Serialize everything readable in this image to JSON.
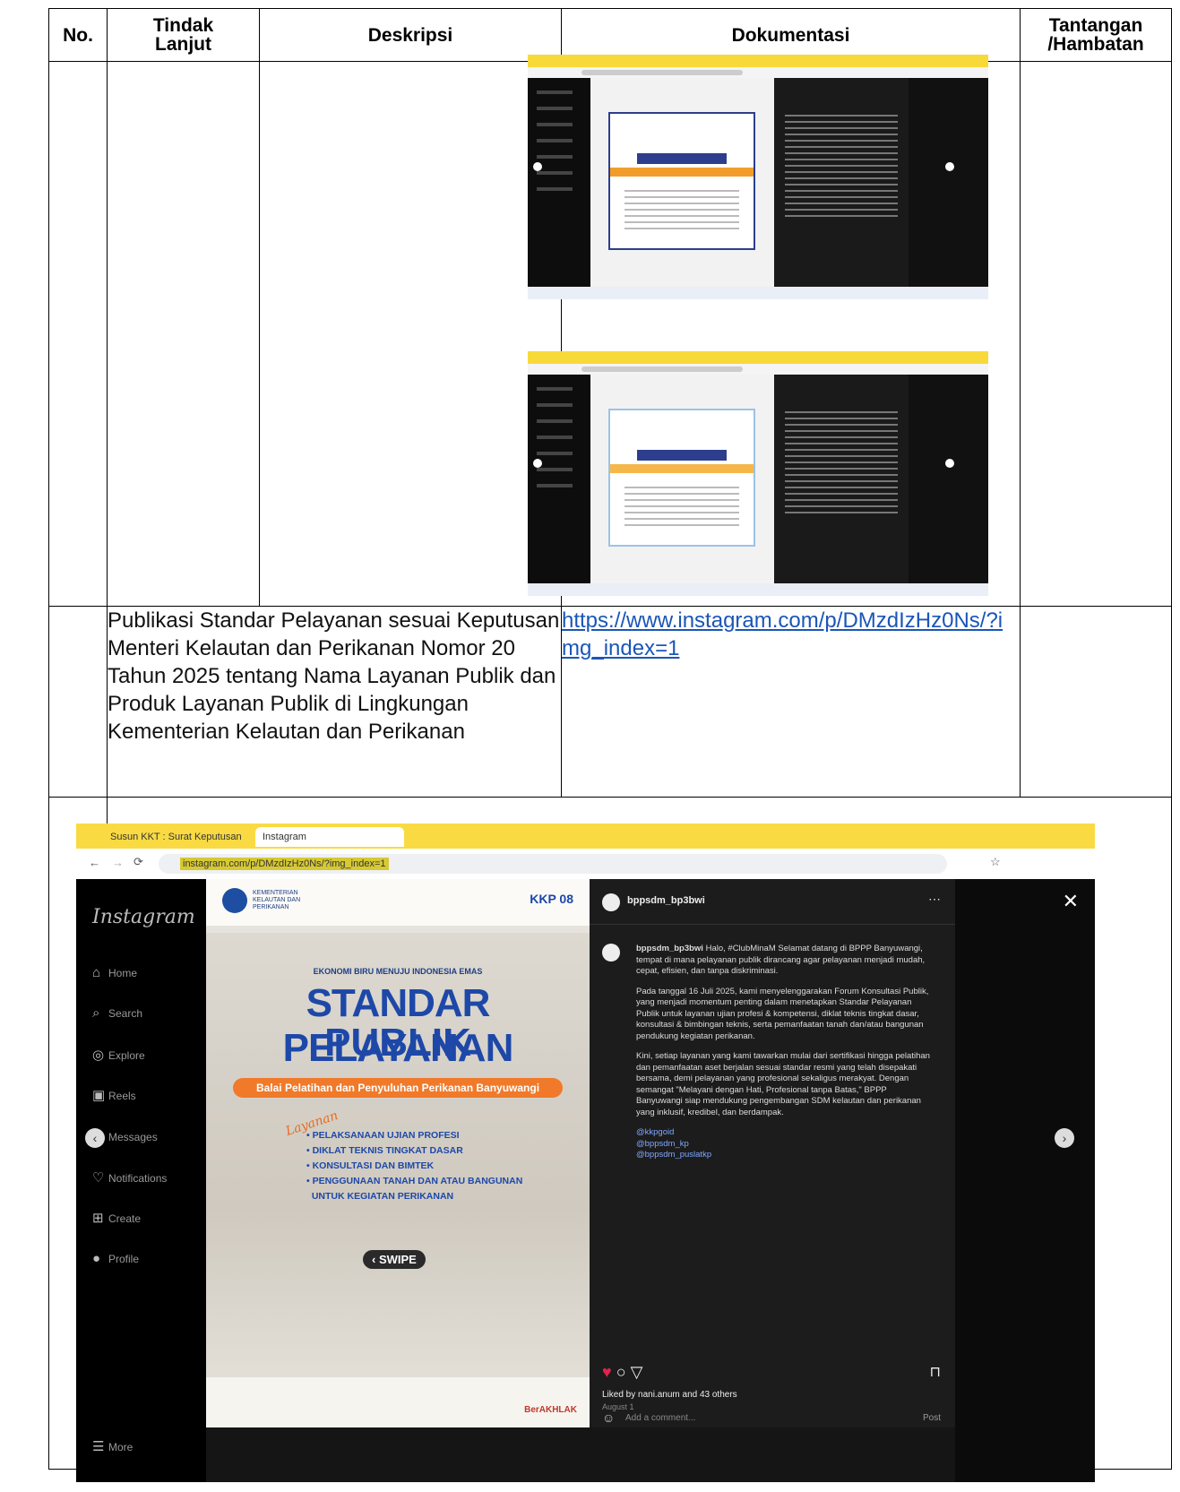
{
  "headers": {
    "no": "No.",
    "tindak_lanjut": "Tindak Lanjut",
    "deskripsi": "Deskripsi",
    "dokumentasi": "Dokumentasi",
    "tantangan": "Tantangan /Hambatan"
  },
  "row2": {
    "description": "Publikasi Standar Pelayanan sesuai Keputusan Menteri Kelautan dan Perikanan Nomor 20 Tahun 2025 tentang Nama Layanan Publik dan Produk Layanan Publik di Lingkungan Kementerian Kelautan dan Perikanan",
    "link": "https://www.instagram.com/p/DMzdIzHz0Ns/?img_index=1"
  },
  "mini_shots": [
    {
      "card_label": "MAKLUMAT",
      "band_color": "#f29d2b"
    },
    {
      "card_label": "MAKLUMAT",
      "band_color": "#f6b74a"
    }
  ],
  "screenshot": {
    "tab1": "Susun KKT : Surat Keputusan",
    "tab2": "Instagram",
    "url": "instagram.com/p/DMzdIzHz0Ns/?img_index=1",
    "sidebar": {
      "logo": "Instagram",
      "items": [
        "Home",
        "Search",
        "Explore",
        "Reels",
        "Messages",
        "Notifications",
        "Create",
        "Profile"
      ],
      "more": "More"
    },
    "post": {
      "org": "KEMENTERIAN KELAUTAN DAN PERIKANAN",
      "eco": "EKONOMI BIRU MENUJU INDONESIA EMAS",
      "title1": "STANDAR PELAYANAN",
      "title2": "PUBLIK",
      "ribbon": "Balai Pelatihan dan Penyuluhan Perikanan Banyuwangi",
      "layanan": "Layanan",
      "services": [
        "PELAKSANAAN UJIAN PROFESI",
        "DIKLAT TEKNIS TINGKAT DASAR",
        "KONSULTASI DAN BIMTEK",
        "PENGGUNAAN TANAH DAN ATAU BANGUNAN",
        "UNTUK KEGIATAN PERIKANAN"
      ],
      "swipe": "SWIPE",
      "berakhlak": "BerAKHLAK",
      "logos": "KKP 08"
    },
    "panel": {
      "username": "bppsdm_bp3bwi",
      "caption_user": "bppsdm_bp3bwi",
      "caption_p1": "Halo, #ClubMinaM Selamat datang di BPPP Banyuwangi, tempat di mana pelayanan publik dirancang agar pelayanan menjadi mudah, cepat, efisien, dan tanpa diskriminasi.",
      "caption_p2": "Pada tanggal 16 Juli 2025, kami menyelenggarakan Forum Konsultasi Publik, yang menjadi momentum penting dalam menetapkan Standar Pelayanan Publik untuk layanan ujian profesi & kompetensi, diklat teknis tingkat dasar, konsultasi & bimbingan teknis, serta pemanfaatan tanah dan/atau bangunan pendukung kegiatan perikanan.",
      "caption_p3": "Kini, setiap layanan yang kami tawarkan mulai dari sertifikasi hingga pelatihan dan pemanfaatan aset berjalan sesuai standar resmi yang telah disepakati bersama, demi pelayanan yang profesional sekaligus merakyat. Dengan semangat \"Melayani dengan Hati, Profesional tanpa Batas,\" BPPP Banyuwangi siap mendukung pengembangan SDM kelautan dan perikanan yang inklusif, kredibel, dan berdampak.",
      "tags": [
        "@kkpgoid",
        "@bppsdm_kp",
        "@bppsdm_puslatkp"
      ],
      "liked": "Liked by nani.anum and 43 others",
      "date": "August 1",
      "comment": "Add a comment...",
      "post_btn": "Post"
    }
  }
}
